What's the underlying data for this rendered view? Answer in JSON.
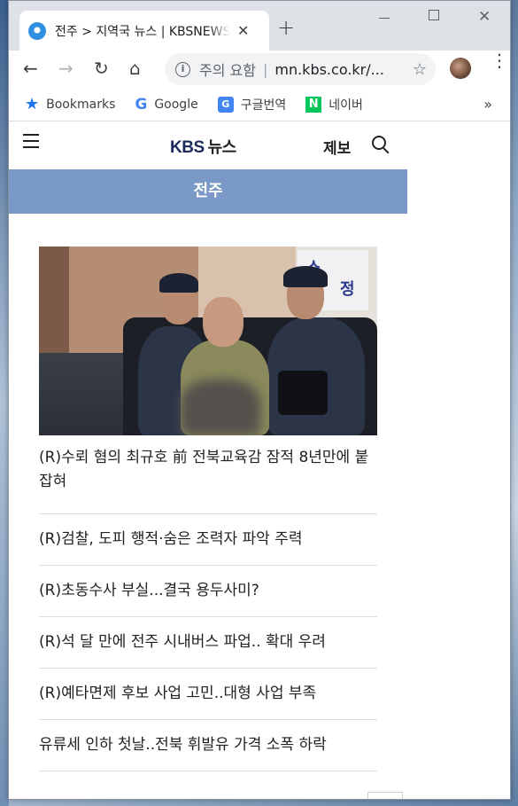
{
  "browser": {
    "tab_title": "전주 > 지역국 뉴스 | KBSNEWS",
    "new_tab_symbol": "+",
    "omnibox_warning": "주의 요함",
    "omnibox_separator": "|",
    "omnibox_url": "mn.kbs.co.kr/...",
    "bookmarks": [
      {
        "label": "Bookmarks",
        "icon": "star-icon"
      },
      {
        "label": "Google",
        "icon": "google-icon"
      },
      {
        "label": "구글번역",
        "icon": "translate-icon"
      },
      {
        "label": "네이버",
        "icon": "naver-icon"
      }
    ],
    "bookmarks_more": "»"
  },
  "site": {
    "logo_kbs": "KBS",
    "logo_news": "뉴스",
    "report_label": "제보",
    "region_title": "전주"
  },
  "news": {
    "lead_title": "(R)수뢰 혐의 최규호 前 전북교육감 잠적 8년만에 붙잡혀",
    "items": [
      "(R)검찰, 도피 행적·숨은 조력자 파악 주력",
      "(R)초동수사 부실...결국 용두사미?",
      "(R)석 달 만에 전주 시내버스 파업.. 확대 우려",
      "(R)예타면제 후보 사업 고민..대형 사업 부족",
      "유류세 인하 첫날..전북 휘발유 가격 소폭 하락"
    ]
  },
  "colors": {
    "region_bar": "#7a99c6",
    "logo": "#1b2a5a",
    "chrome_frame": "#dee1e6"
  }
}
